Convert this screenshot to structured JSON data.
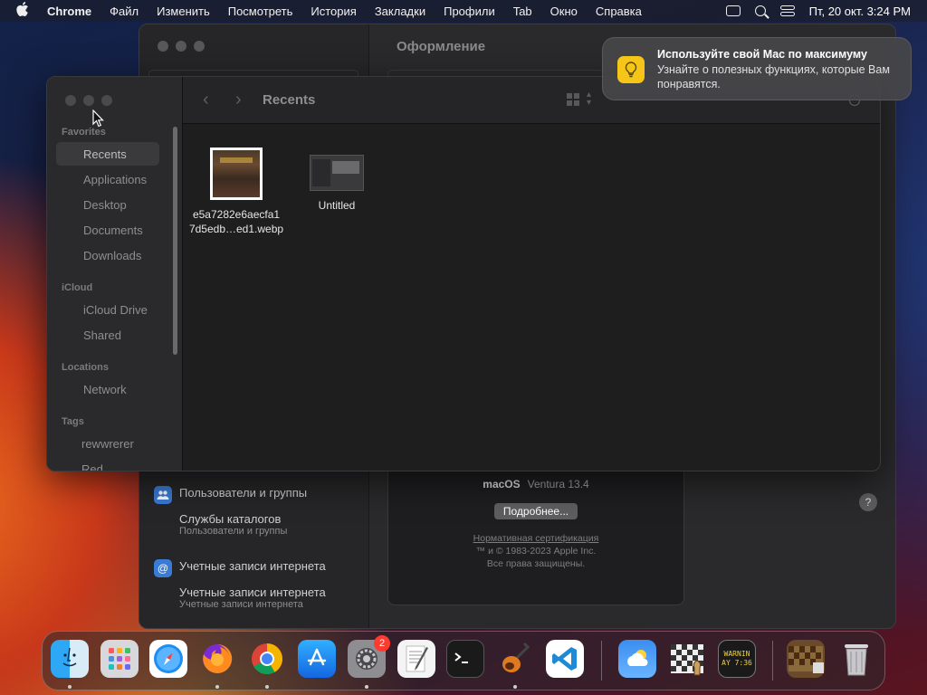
{
  "menubar": {
    "apple": "",
    "app": "Chrome",
    "items": [
      "Файл",
      "Изменить",
      "Посмотреть",
      "История",
      "Закладки",
      "Профили",
      "Tab",
      "Окно",
      "Справка"
    ],
    "datetime": "Пт, 20 окт.  3:24 PM"
  },
  "settings": {
    "title": "Оформление",
    "sidebar": [
      {
        "label": "Пользователи и группы",
        "sub": ""
      },
      {
        "label": "Службы каталогов",
        "sub": "Пользователи и группы"
      },
      {
        "label": "Учетные записи интернета",
        "sub": ""
      },
      {
        "label": "Учетные записи интернета",
        "sub": "Учетные записи интернета"
      }
    ],
    "about": {
      "os_name": "macOS",
      "os_version": "Ventura 13.4",
      "more_button": "Подробнее...",
      "cert_link": "Нормативная сертификация",
      "copyright": "™ и © 1983-2023 Apple Inc.",
      "rights": "Все права защищены."
    },
    "help": "?"
  },
  "finder": {
    "title": "Recents",
    "nav_back": "‹",
    "nav_forward": "›",
    "sections": {
      "favorites": "Favorites",
      "icloud": "iCloud",
      "locations": "Locations",
      "tags": "Tags"
    },
    "favorites": [
      "Recents",
      "Applications",
      "Desktop",
      "Documents",
      "Downloads"
    ],
    "icloud": [
      "iCloud Drive",
      "Shared"
    ],
    "locations": [
      "Network"
    ],
    "tags": [
      {
        "label": "rewwrerer",
        "color": "#8e8e90"
      },
      {
        "label": "Red",
        "color": "#ff453a"
      }
    ],
    "files": [
      {
        "name_line1": "e5a7282e6aecfa1",
        "name_line2": "7d5edb…ed1.webp"
      },
      {
        "name_line1": "Untitled",
        "name_line2": ""
      }
    ]
  },
  "notification": {
    "title": "Используйте свой Mac по максимуму",
    "body": "Узнайте о полезных функциях, которые Вам понравятся."
  },
  "dock": {
    "apps": [
      "Finder",
      "Launchpad",
      "Safari",
      "Firefox",
      "Chrome",
      "App Store",
      "System Settings",
      "TextEdit",
      "Terminal",
      "GarageBand",
      "Visual Studio Code",
      "Weather",
      "Chess",
      "Console",
      "Chess Game",
      "Trash"
    ],
    "settings_badge": "2",
    "console_text": "WARNIN AY 7:36"
  }
}
